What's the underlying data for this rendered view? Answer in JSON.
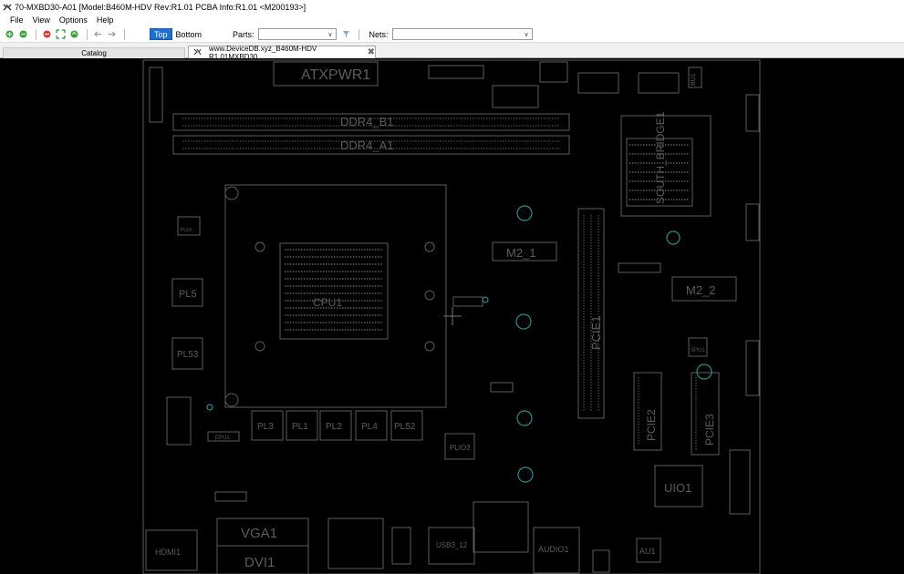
{
  "window": {
    "title": "70-MXBD30-A01 [Model:B460M-HDV Rev:R1.01 PCBA Info:R1.01   <M200193>]"
  },
  "menu": [
    "File",
    "View",
    "Options",
    "Help"
  ],
  "toolbar": {
    "top_label": "Top",
    "bottom_label": "Bottom",
    "parts_label": "Parts:",
    "parts_value": "",
    "nets_label": "Nets:",
    "nets_value": "",
    "active_layer": "Top"
  },
  "tabs": {
    "catalog": "Catalog",
    "board": "www.DeviceDB.xyz_B460M-HDV R1.01MXBD30"
  },
  "board_labels": {
    "atxpwr": "ATXPWR1",
    "ddr4_b1": "DDR4_B1",
    "ddr4_a1": "DDR4_A1",
    "south": "SOUTH_BRIDGE1",
    "m2_1": "M2_1",
    "m2_2": "M2_2",
    "pcie1": "PCIE1",
    "pcie2": "PCIE2",
    "pcie3": "PCIE3",
    "pl5": "PL5",
    "pl53": "PL53",
    "pl3": "PL3",
    "pl1": "PL1",
    "pl2": "PL2",
    "pl4": "PL4",
    "pl52": "PL52",
    "plio2": "PLIO2",
    "uio1": "UIO1",
    "au1": "AU1",
    "vga1": "VGA1",
    "dvi1": "DVI1",
    "hdmi1": "HDMI1",
    "usb3": "USB3_12",
    "audio1": "AUDIO1",
    "spu1": "SPU1",
    "plsx": "PL5X",
    "bu1": "BU1",
    "epu1": "EPU1",
    "cpu": "CPU1"
  },
  "colors": {
    "accent": "#1d6fd6",
    "board_bg": "#000000",
    "trace_gray": "#5c5c5c",
    "via_teal": "#2b8c8c"
  }
}
